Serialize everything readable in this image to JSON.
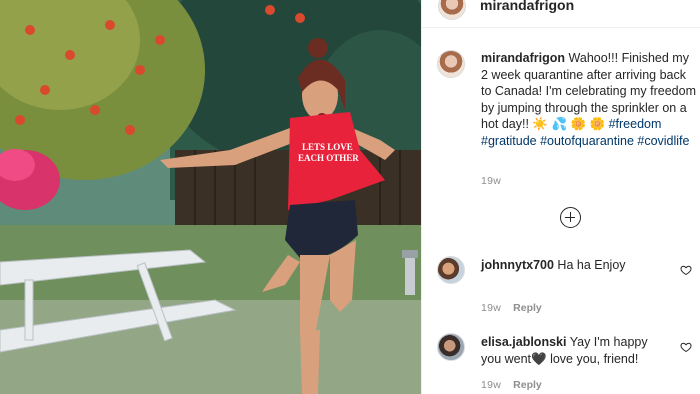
{
  "post": {
    "header_username": "mirandafrigon",
    "image_shirt_text": "LETS LOVE EACH OTHER",
    "caption": {
      "username": "mirandafrigon",
      "text": "Wahoo!!! Finished my 2 week quarantine after arriving back to Canada! I'm celebrating my freedom by jumping through the sprinkler on a hot day!! ☀️ 💦 🌼 🌼",
      "hashtags": "#freedom #gratitude #outofquarantine #covidlife",
      "time": "19w"
    },
    "load_more_icon": "plus-circle-icon"
  },
  "comments": [
    {
      "username": "johnnytx700",
      "text": "Ha ha Enjoy",
      "time": "19w",
      "reply_label": "Reply"
    },
    {
      "username": "elisa.jablonski",
      "text": "Yay I'm happy you went🖤 love you, friend!",
      "time": "19w",
      "reply_label": "Reply"
    }
  ],
  "colors": {
    "hashtag": "#00376b",
    "muted": "#8e8e8e",
    "shirt": "#e8223a"
  }
}
